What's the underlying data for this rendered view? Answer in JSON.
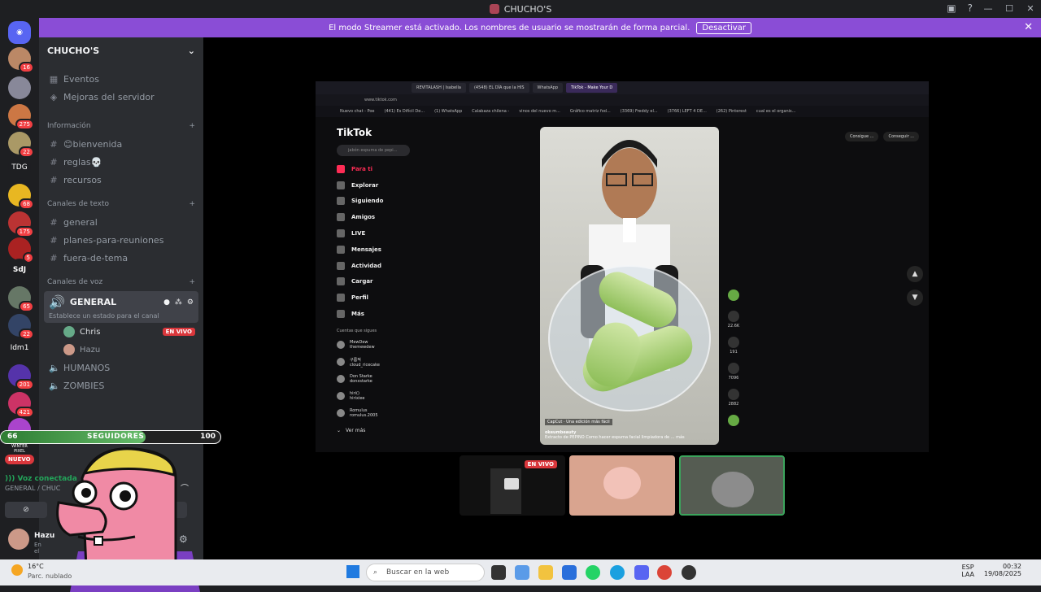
{
  "window": {
    "title": "CHUCHO'S"
  },
  "banner": {
    "text": "El modo Streamer está activado. Los nombres de usuario se mostrarán de forma parcial.",
    "button": "Desactivar"
  },
  "guilds": [
    {
      "label": "",
      "badge": "16"
    },
    {
      "label": "",
      "badge": ""
    },
    {
      "label": "",
      "badge": "275"
    },
    {
      "label": "",
      "badge": "22"
    },
    {
      "label": "TDG",
      "badge": ""
    },
    {
      "label": "",
      "badge": "68"
    },
    {
      "label": "",
      "badge": "175"
    },
    {
      "label": "",
      "badge": "5"
    },
    {
      "label": "SdJ",
      "badge": ""
    },
    {
      "label": "",
      "badge": "65"
    },
    {
      "label": "",
      "badge": "22"
    },
    {
      "label": "Idm1",
      "badge": ""
    },
    {
      "label": "",
      "badge": "201"
    },
    {
      "label": "",
      "badge": "421"
    }
  ],
  "server": {
    "name": "CHUCHO'S",
    "events": "Eventos",
    "boosts": "Mejoras del servidor",
    "categories": {
      "info": "Información",
      "text": "Canales de texto",
      "voice": "Canales de voz"
    },
    "info_channels": [
      "😊bienvenida",
      "reglas💀",
      "recursos"
    ],
    "text_channels": [
      "general",
      "planes-para-reuniones",
      "fuera-de-tema"
    ],
    "voice_active": {
      "name": "GENERAL",
      "status": "Establece un estado para el canal"
    },
    "members": [
      {
        "name": "Chris",
        "live": "EN VIVO"
      },
      {
        "name": "Hazu",
        "live": ""
      }
    ],
    "other_voice": [
      "HUMANOS",
      "ZOMBIES"
    ]
  },
  "overlay": {
    "left_num": "66",
    "label": "SEGUIDORES",
    "right_num": "100",
    "progress": 0.66,
    "nuevo": "NUEVO",
    "winter": "WINTER PIXEL"
  },
  "voice_panel": {
    "status": "Voz conectada",
    "channel": "GENERAL / CHUC",
    "user": "Hazu",
    "user_status": "En el"
  },
  "stream": {
    "tabs": [
      "REVITALASH | Isabella",
      "(4548) EL DÍA que la HIS",
      "WhatsApp",
      "TikTok - Make Your D"
    ],
    "url": "www.tiktok.com",
    "bookmarks": [
      "Nuevo chat - Poe",
      "(441) Es Difícil De...",
      "(1) WhatsApp",
      "Calabaza chilena -",
      "vinos del nuevo m...",
      "Gráfico matriz fod...",
      "(3369) Freddy el...",
      "(3766) LEFT 4 DE...",
      "(262) Pinterest",
      "cual es el organis..."
    ],
    "tiktok": {
      "logo": "TikTok",
      "search": "jabón espuma de pepi...",
      "nav": [
        "Para ti",
        "Explorar",
        "Siguiendo",
        "Amigos",
        "LIVE",
        "Mensajes",
        "Actividad",
        "Cargar",
        "Perfil",
        "Más"
      ],
      "following_title": "Cuentas que sigues",
      "following": [
        {
          "name": "MewDew",
          "handle": "themewdew"
        },
        {
          "name": "구름적",
          "handle": "cloud_ricecake"
        },
        {
          "name": "Don Starke",
          "handle": "donxstarke"
        },
        {
          "name": "hiri()",
          "handle": "hirixiee"
        },
        {
          "name": "Romulus",
          "handle": "romulus.2005"
        }
      ],
      "see_more": "Ver más",
      "top_buttons": [
        "Consigue ...",
        "Conseguir ..."
      ],
      "caption_tag": "CapCut · Una edición más fácil",
      "caption_user": "okeumbeauty",
      "caption_text": "Extracto de PEPINO Como hacer espuma facial limpiadora de ...",
      "caption_more": "más",
      "counts": [
        "22.6K",
        "191",
        "7096",
        "2882"
      ]
    },
    "thumb_live": "EN VIVO"
  },
  "taskbar": {
    "temp": "16°C",
    "weather": "Parc. nublado",
    "search": "Buscar en la web",
    "lang": "ESP",
    "lang2": "LAA",
    "time": "00:32",
    "date": "19/08/2025"
  }
}
